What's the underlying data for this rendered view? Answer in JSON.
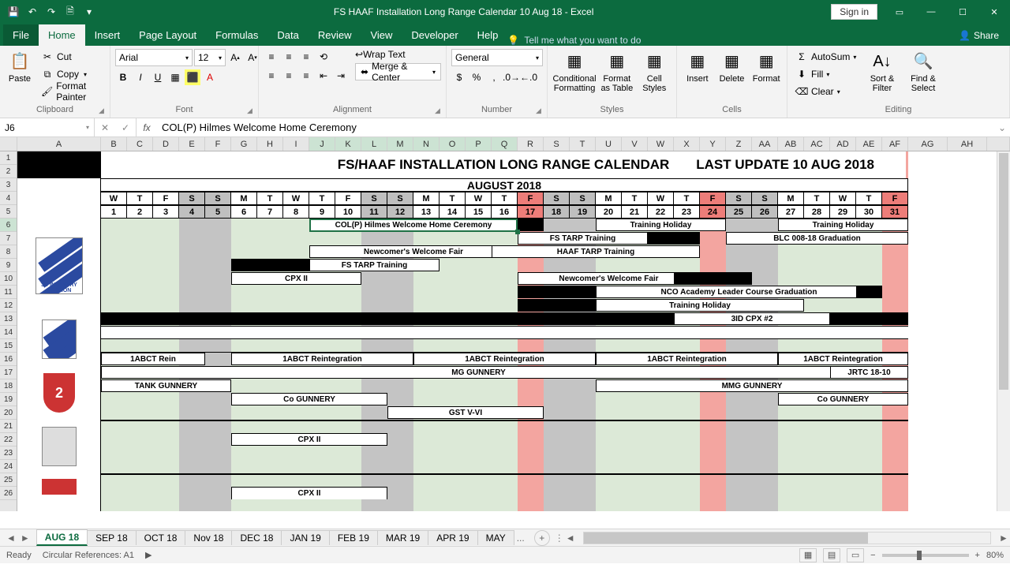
{
  "titlebar": {
    "title": "FS HAAF Installation Long Range Calendar 10 Aug 18  -  Excel",
    "signin": "Sign in"
  },
  "tabs": {
    "file": "File",
    "home": "Home",
    "insert": "Insert",
    "pagelayout": "Page Layout",
    "formulas": "Formulas",
    "data": "Data",
    "review": "Review",
    "view": "View",
    "developer": "Developer",
    "help": "Help",
    "tellme": "Tell me what you want to do",
    "share": "Share"
  },
  "ribbon": {
    "clipboard": {
      "label": "Clipboard",
      "paste": "Paste",
      "cut": "Cut",
      "copy": "Copy",
      "painter": "Format Painter"
    },
    "font": {
      "label": "Font",
      "name": "Arial",
      "size": "12"
    },
    "alignment": {
      "label": "Alignment",
      "wrap": "Wrap Text",
      "merge": "Merge & Center"
    },
    "number": {
      "label": "Number",
      "format": "General"
    },
    "styles": {
      "label": "Styles",
      "cond": "Conditional Formatting",
      "table": "Format as Table",
      "cell": "Cell Styles"
    },
    "cells": {
      "label": "Cells",
      "insert": "Insert",
      "delete": "Delete",
      "format": "Format"
    },
    "editing": {
      "label": "Editing",
      "autosum": "AutoSum",
      "fill": "Fill",
      "clear": "Clear",
      "sort": "Sort & Filter",
      "find": "Find & Select"
    }
  },
  "fbar": {
    "cell": "J6",
    "formula": "COL(P) Hilmes Welcome Home Ceremony"
  },
  "columns": [
    "A",
    "B",
    "C",
    "D",
    "E",
    "F",
    "G",
    "H",
    "I",
    "J",
    "K",
    "L",
    "M",
    "N",
    "O",
    "P",
    "Q",
    "R",
    "S",
    "T",
    "U",
    "V",
    "W",
    "X",
    "Y",
    "Z",
    "AA",
    "AB",
    "AC",
    "AD",
    "AE",
    "AF"
  ],
  "tailcols": [
    "AG",
    "AH"
  ],
  "rows": [
    "1",
    "2",
    "3",
    "4",
    "5",
    "6",
    "7",
    "8",
    "9",
    "10",
    "11",
    "12",
    "13",
    "14",
    "15",
    "16",
    "17",
    "18",
    "19",
    "20",
    "21",
    "22",
    "23",
    "24",
    "25",
    "26"
  ],
  "calendar": {
    "title1": "FS/HAAF INSTALLATION LONG RANGE CALENDAR",
    "title2": "LAST UPDATE 10 AUG 2018",
    "month": "AUGUST 2018",
    "dow": [
      "W",
      "T",
      "F",
      "S",
      "S",
      "M",
      "T",
      "W",
      "T",
      "F",
      "S",
      "S",
      "M",
      "T",
      "W",
      "T",
      "F",
      "S",
      "S",
      "M",
      "T",
      "W",
      "T",
      "F",
      "S",
      "S",
      "M",
      "T",
      "W",
      "T",
      "F"
    ],
    "dates": [
      "1",
      "2",
      "3",
      "4",
      "5",
      "6",
      "7",
      "8",
      "9",
      "10",
      "11",
      "12",
      "13",
      "14",
      "15",
      "16",
      "17",
      "18",
      "19",
      "20",
      "21",
      "22",
      "23",
      "24",
      "25",
      "26",
      "27",
      "28",
      "29",
      "30",
      "31"
    ],
    "weekend_idx": [
      3,
      4,
      10,
      11,
      17,
      18,
      24,
      25
    ],
    "red_idx": [
      16,
      23,
      30
    ],
    "logo_label": "3D INFANTRY DIVISION"
  },
  "events": {
    "r6a": "COL(P) Hilmes Welcome Home Ceremony",
    "r6b": "Training Holiday",
    "r6c": "Training Holiday",
    "r7a": "FS TARP Training",
    "r7b": "BLC 008-18 Graduation",
    "r8a": "Newcomer's Welcome Fair",
    "r8b": "HAAF TARP Training",
    "r9a": "FS TARP Training",
    "r10a": "CPX II",
    "r10b": "Newcomer's Welcome Fair",
    "r11a": "NCO Academy Leader Course Graduation",
    "r12a": "Training Holiday",
    "r13a": "3ID CPX #2",
    "r16a": "1ABCT Rein",
    "r16b": "1ABCT Reintegration",
    "r16c": "1ABCT Reintegration",
    "r16d": "1ABCT Reintegration",
    "r16e": "1ABCT Reintegration",
    "r17a": "MG GUNNERY",
    "r17b": "JRTC 18-10",
    "r18a": "TANK GUNNERY",
    "r18b": "MMG GUNNERY",
    "r19a": "Co GUNNERY",
    "r19b": "Co GUNNERY",
    "r20a": "GST V-VI",
    "r22a": "CPX II",
    "r26a": "CPX II"
  },
  "sheets": {
    "active": "AUG 18",
    "tabs": [
      "SEP 18",
      "OCT 18",
      "Nov 18",
      "DEC 18",
      "JAN 19",
      "FEB 19",
      "MAR 19",
      "APR 19",
      "MAY"
    ],
    "more": "..."
  },
  "status": {
    "ready": "Ready",
    "circ": "Circular References: A1",
    "zoom": "80%"
  }
}
